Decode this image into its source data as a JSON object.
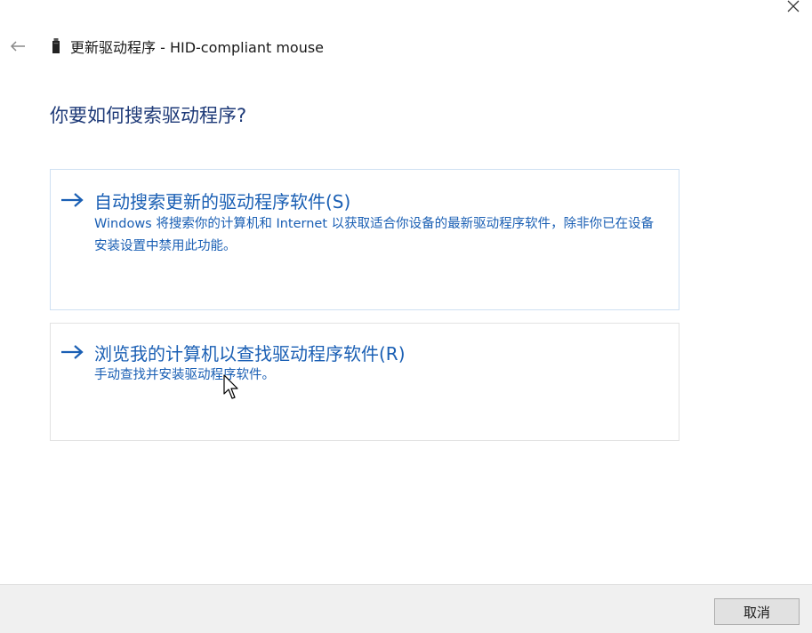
{
  "window": {
    "title": "更新驱动程序 - HID-compliant mouse",
    "close_icon": "close-icon",
    "back_icon": "back-arrow-icon",
    "device_icon": "usb-device-icon"
  },
  "main": {
    "heading": "你要如何搜索驱动程序?"
  },
  "options": [
    {
      "title": "自动搜索更新的驱动程序软件(S)",
      "description": "Windows 将搜索你的计算机和 Internet 以获取适合你设备的最新驱动程序软件，除非你已在设备安装设置中禁用此功能。",
      "icon": "arrow-right-icon"
    },
    {
      "title": "浏览我的计算机以查找驱动程序软件(R)",
      "description": "手动查找并安装驱动程序软件。",
      "icon": "arrow-right-icon"
    }
  ],
  "footer": {
    "cancel_label": "取消"
  },
  "colors": {
    "heading": "#1e3a78",
    "link": "#1a5fb4",
    "footer_bg": "#f0f0f0",
    "option_border_selected": "#cfe0f2",
    "option_border": "#e2e2e2"
  }
}
